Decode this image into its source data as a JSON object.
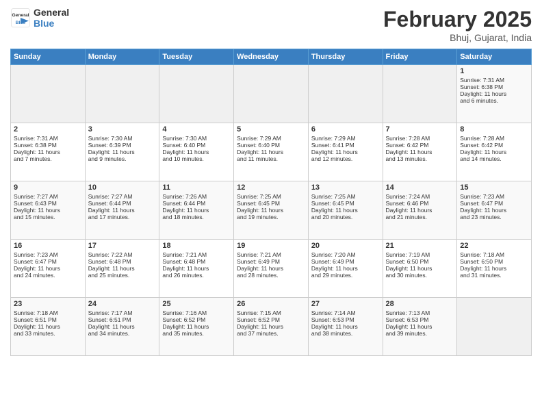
{
  "header": {
    "logo_line1": "General",
    "logo_line2": "Blue",
    "title": "February 2025",
    "subtitle": "Bhuj, Gujarat, India"
  },
  "weekdays": [
    "Sunday",
    "Monday",
    "Tuesday",
    "Wednesday",
    "Thursday",
    "Friday",
    "Saturday"
  ],
  "weeks": [
    [
      {
        "day": "",
        "info": ""
      },
      {
        "day": "",
        "info": ""
      },
      {
        "day": "",
        "info": ""
      },
      {
        "day": "",
        "info": ""
      },
      {
        "day": "",
        "info": ""
      },
      {
        "day": "",
        "info": ""
      },
      {
        "day": "1",
        "info": "Sunrise: 7:31 AM\nSunset: 6:38 PM\nDaylight: 11 hours\nand 6 minutes."
      }
    ],
    [
      {
        "day": "2",
        "info": "Sunrise: 7:31 AM\nSunset: 6:38 PM\nDaylight: 11 hours\nand 7 minutes."
      },
      {
        "day": "3",
        "info": "Sunrise: 7:30 AM\nSunset: 6:39 PM\nDaylight: 11 hours\nand 9 minutes."
      },
      {
        "day": "4",
        "info": "Sunrise: 7:30 AM\nSunset: 6:40 PM\nDaylight: 11 hours\nand 10 minutes."
      },
      {
        "day": "5",
        "info": "Sunrise: 7:29 AM\nSunset: 6:40 PM\nDaylight: 11 hours\nand 11 minutes."
      },
      {
        "day": "6",
        "info": "Sunrise: 7:29 AM\nSunset: 6:41 PM\nDaylight: 11 hours\nand 12 minutes."
      },
      {
        "day": "7",
        "info": "Sunrise: 7:28 AM\nSunset: 6:42 PM\nDaylight: 11 hours\nand 13 minutes."
      },
      {
        "day": "8",
        "info": "Sunrise: 7:28 AM\nSunset: 6:42 PM\nDaylight: 11 hours\nand 14 minutes."
      }
    ],
    [
      {
        "day": "9",
        "info": "Sunrise: 7:27 AM\nSunset: 6:43 PM\nDaylight: 11 hours\nand 15 minutes."
      },
      {
        "day": "10",
        "info": "Sunrise: 7:27 AM\nSunset: 6:44 PM\nDaylight: 11 hours\nand 17 minutes."
      },
      {
        "day": "11",
        "info": "Sunrise: 7:26 AM\nSunset: 6:44 PM\nDaylight: 11 hours\nand 18 minutes."
      },
      {
        "day": "12",
        "info": "Sunrise: 7:25 AM\nSunset: 6:45 PM\nDaylight: 11 hours\nand 19 minutes."
      },
      {
        "day": "13",
        "info": "Sunrise: 7:25 AM\nSunset: 6:45 PM\nDaylight: 11 hours\nand 20 minutes."
      },
      {
        "day": "14",
        "info": "Sunrise: 7:24 AM\nSunset: 6:46 PM\nDaylight: 11 hours\nand 21 minutes."
      },
      {
        "day": "15",
        "info": "Sunrise: 7:23 AM\nSunset: 6:47 PM\nDaylight: 11 hours\nand 23 minutes."
      }
    ],
    [
      {
        "day": "16",
        "info": "Sunrise: 7:23 AM\nSunset: 6:47 PM\nDaylight: 11 hours\nand 24 minutes."
      },
      {
        "day": "17",
        "info": "Sunrise: 7:22 AM\nSunset: 6:48 PM\nDaylight: 11 hours\nand 25 minutes."
      },
      {
        "day": "18",
        "info": "Sunrise: 7:21 AM\nSunset: 6:48 PM\nDaylight: 11 hours\nand 26 minutes."
      },
      {
        "day": "19",
        "info": "Sunrise: 7:21 AM\nSunset: 6:49 PM\nDaylight: 11 hours\nand 28 minutes."
      },
      {
        "day": "20",
        "info": "Sunrise: 7:20 AM\nSunset: 6:49 PM\nDaylight: 11 hours\nand 29 minutes."
      },
      {
        "day": "21",
        "info": "Sunrise: 7:19 AM\nSunset: 6:50 PM\nDaylight: 11 hours\nand 30 minutes."
      },
      {
        "day": "22",
        "info": "Sunrise: 7:18 AM\nSunset: 6:50 PM\nDaylight: 11 hours\nand 31 minutes."
      }
    ],
    [
      {
        "day": "23",
        "info": "Sunrise: 7:18 AM\nSunset: 6:51 PM\nDaylight: 11 hours\nand 33 minutes."
      },
      {
        "day": "24",
        "info": "Sunrise: 7:17 AM\nSunset: 6:51 PM\nDaylight: 11 hours\nand 34 minutes."
      },
      {
        "day": "25",
        "info": "Sunrise: 7:16 AM\nSunset: 6:52 PM\nDaylight: 11 hours\nand 35 minutes."
      },
      {
        "day": "26",
        "info": "Sunrise: 7:15 AM\nSunset: 6:52 PM\nDaylight: 11 hours\nand 37 minutes."
      },
      {
        "day": "27",
        "info": "Sunrise: 7:14 AM\nSunset: 6:53 PM\nDaylight: 11 hours\nand 38 minutes."
      },
      {
        "day": "28",
        "info": "Sunrise: 7:13 AM\nSunset: 6:53 PM\nDaylight: 11 hours\nand 39 minutes."
      },
      {
        "day": "",
        "info": ""
      }
    ]
  ]
}
